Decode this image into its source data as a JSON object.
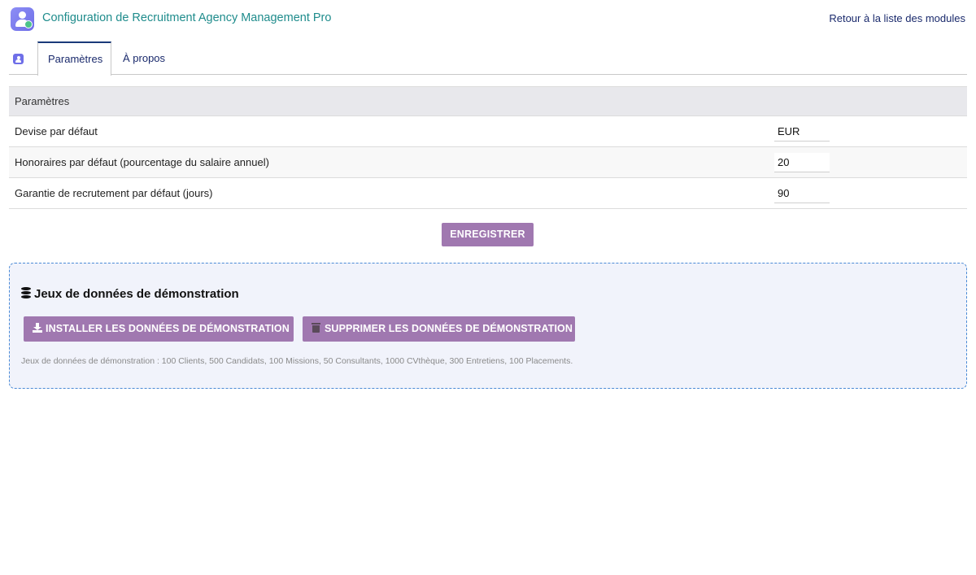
{
  "header": {
    "title": "Configuration de Recruitment Agency Management Pro",
    "back_link": "Retour à la liste des modules"
  },
  "tabs": [
    {
      "label": "Paramètres",
      "active": true
    },
    {
      "label": "À propos",
      "active": false
    }
  ],
  "settings": {
    "section_title": "Paramètres",
    "rows": [
      {
        "label": "Devise par défaut",
        "value": "EUR"
      },
      {
        "label": "Honoraires par défaut (pourcentage du salaire annuel)",
        "value": "20"
      },
      {
        "label": "Garantie de recrutement par défaut (jours)",
        "value": "90"
      }
    ],
    "save_label": "ENREGISTRER"
  },
  "demo": {
    "title": "Jeux de données de démonstration",
    "install_label": "INSTALLER LES DONNÉES DE DÉMONSTRATION",
    "delete_label": "SUPPRIMER LES DONNÉES DE DÉMONSTRATION",
    "note": "Jeux de données de démonstration : 100 Clients, 500 Candidats, 100 Missions, 50 Consultants, 1000 CVthèque, 300 Entretiens, 100 Placements."
  },
  "colors": {
    "accent_button": "#a078b0",
    "title_teal": "#1f8c8c",
    "link_navy": "#1a2a6c",
    "demo_border": "#4a8ad6"
  },
  "icons": [
    "app-user-check-icon",
    "module-user-icon",
    "database-icon",
    "download-icon",
    "trash-icon"
  ]
}
